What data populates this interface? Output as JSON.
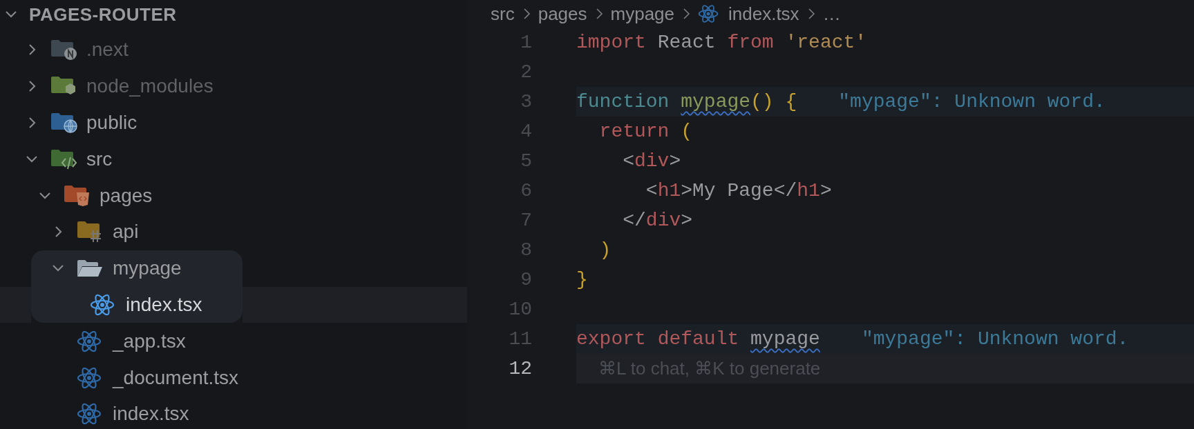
{
  "explorer": {
    "title": "PAGES-ROUTER",
    "expanded": true,
    "tree": [
      {
        "name": ".next",
        "kind": "next-folder",
        "expanded": false,
        "ignored": true,
        "selected": false
      },
      {
        "name": "node_modules",
        "kind": "node-folder",
        "expanded": false,
        "ignored": true,
        "selected": false
      },
      {
        "name": "public",
        "kind": "public-folder",
        "expanded": false,
        "ignored": false,
        "selected": false
      },
      {
        "name": "src",
        "kind": "src-folder",
        "expanded": true,
        "ignored": false,
        "selected": false,
        "children": [
          {
            "name": "pages",
            "kind": "pages-folder",
            "expanded": true,
            "ignored": false,
            "selected": false,
            "children": [
              {
                "name": "api",
                "kind": "api-folder",
                "expanded": false,
                "ignored": false,
                "selected": false
              },
              {
                "name": "mypage",
                "kind": "folder",
                "expanded": true,
                "ignored": false,
                "selected": false,
                "highlighted": true,
                "children": [
                  {
                    "name": "index.tsx",
                    "kind": "react-file",
                    "ignored": false,
                    "selected": true
                  }
                ]
              },
              {
                "name": "_app.tsx",
                "kind": "react-file",
                "ignored": false,
                "selected": false
              },
              {
                "name": "_document.tsx",
                "kind": "react-file",
                "ignored": false,
                "selected": false
              },
              {
                "name": "index.tsx",
                "kind": "react-file",
                "ignored": false,
                "selected": false
              }
            ]
          }
        ]
      }
    ]
  },
  "editor": {
    "breadcrumbs": [
      {
        "text": "src",
        "kind": "folder"
      },
      {
        "text": "pages",
        "kind": "folder"
      },
      {
        "text": "mypage",
        "kind": "folder"
      },
      {
        "text": "index.tsx",
        "kind": "react-file"
      },
      {
        "text": "…",
        "kind": "more"
      }
    ],
    "lines": [
      {
        "number": "1",
        "active": false,
        "tokens": [
          {
            "t": "import ",
            "kind": "keyword"
          },
          {
            "t": "React ",
            "kind": "plain"
          },
          {
            "t": "from ",
            "kind": "keyword"
          },
          {
            "t": "'react'",
            "kind": "string"
          }
        ]
      },
      {
        "number": "2",
        "active": false
      },
      {
        "number": "3",
        "active": false,
        "tokens": [
          {
            "t": "function ",
            "kind": "storage"
          },
          {
            "t": "mypage",
            "kind": "func",
            "error": true
          },
          {
            "t": "() ",
            "kind": "bracket"
          },
          {
            "t": "{",
            "kind": "bracket"
          }
        ],
        "diagnostic": "\"mypage\": Unknown word."
      },
      {
        "number": "4",
        "active": false,
        "tokens": [
          {
            "t": "  return ",
            "kind": "keyword"
          },
          {
            "t": "(",
            "kind": "bracket"
          }
        ]
      },
      {
        "number": "5",
        "active": false,
        "tokens": [
          {
            "t": "    <",
            "kind": "plain"
          },
          {
            "t": "div",
            "kind": "tag"
          },
          {
            "t": ">",
            "kind": "plain"
          }
        ]
      },
      {
        "number": "6",
        "active": false,
        "tokens": [
          {
            "t": "      <",
            "kind": "plain"
          },
          {
            "t": "h1",
            "kind": "tag"
          },
          {
            "t": ">My Page</",
            "kind": "plain"
          },
          {
            "t": "h1",
            "kind": "tag"
          },
          {
            "t": ">",
            "kind": "plain"
          }
        ]
      },
      {
        "number": "7",
        "active": false,
        "tokens": [
          {
            "t": "    </",
            "kind": "plain"
          },
          {
            "t": "div",
            "kind": "tag"
          },
          {
            "t": ">",
            "kind": "plain"
          }
        ]
      },
      {
        "number": "8",
        "active": false,
        "tokens": [
          {
            "t": "  )",
            "kind": "bracket"
          }
        ]
      },
      {
        "number": "9",
        "active": false,
        "tokens": [
          {
            "t": "}",
            "kind": "bracket"
          }
        ]
      },
      {
        "number": "10",
        "active": false
      },
      {
        "number": "11",
        "active": false,
        "tokens": [
          {
            "t": "export ",
            "kind": "keyword"
          },
          {
            "t": "default ",
            "kind": "keyword"
          },
          {
            "t": "mypage",
            "kind": "plain",
            "error": true
          }
        ],
        "diagnostic": "\"mypage\": Unknown word."
      },
      {
        "number": "12",
        "active": true,
        "hint": "⌘L to chat, ⌘K to generate"
      }
    ]
  }
}
